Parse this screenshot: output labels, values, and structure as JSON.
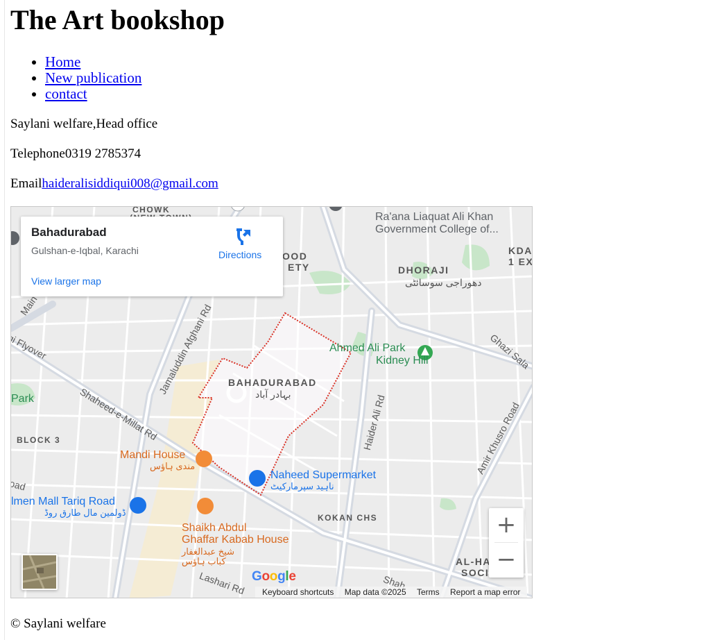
{
  "header": {
    "title": "The Art bookshop"
  },
  "nav": [
    {
      "label": "Home"
    },
    {
      "label": "New publication"
    },
    {
      "label": "contact"
    }
  ],
  "contact": {
    "address": "Saylani welfare,Head office",
    "telephone_label": "Telephone",
    "telephone": "0319 2785374",
    "email_label": "Email",
    "email": "haideralisiddiqui008@gmail.com"
  },
  "map": {
    "card": {
      "title": "Bahadurabad",
      "address": "Gulshan-e-Iqbal, Karachi",
      "directions": "Directions",
      "view_larger": "View larger map"
    },
    "labels": {
      "bahadurabad": "BAHADURABAD",
      "bahadurabad_ur": "بہادر آباد",
      "dhoraji": "DHORAJI",
      "dhoraji_ur": "دھوراجی سوسائٹی",
      "ahmed_ali_park": "Ahmed Ali Park",
      "kidney_hill": "Kidney Hill",
      "government_college_1": "Ra'ana Liaquat Ali Khan",
      "government_college_2": "Government College of...",
      "mandi_house": "Mandi House",
      "mandi_house_ur": "مندی ہاؤس",
      "naheed": "Naheed Supermarket",
      "naheed_ur": "ناہید سپرمارکیٹ",
      "dolmen": "lmen Mall Tariq Road",
      "dolmen_ur": "ڈولمین مال طارق روڈ",
      "shaikh_1": "Shaikh Abdul",
      "shaikh_2": "Ghaffar Kabab House",
      "shaikh_ur_1": "شیخ عبدالغفار",
      "shaikh_ur_2": "کباب ہاؤس",
      "kokan": "KOKAN CHS",
      "block3": "BLOCK 3",
      "park": "Park",
      "chowk": "CHOWK",
      "new_town": "(NEW TOWN)",
      "good_society": "OOD",
      "good_society_2": "ETY",
      "kda": "KDA",
      "kda_2": "1 EX",
      "al_ha": "AL-HA",
      "soc": "SOCI",
      "shaheed_millat": "Shaheed-e-Millat Rd",
      "jamaluddin": "Jamaluddin Afghani Rd",
      "haider_ali": "Haider Ali Rd",
      "amir_khusro": "Amir Khusro Road",
      "ghazi_sala": "Ghazi Sala",
      "flyover": "gi Flyover",
      "main_u": "Main U",
      "lashari": "Lashari Rd",
      "shah": "Shah",
      "oad": "oad"
    },
    "zoom_in": "+",
    "zoom_out": "−",
    "google": "Google",
    "footer": {
      "keyboard": "Keyboard shortcuts",
      "map_data": "Map data ©2025",
      "terms": "Terms",
      "report": "Report a map error"
    },
    "colors": {
      "land": "#ececec",
      "road": "#ffffff",
      "boundary": "#d93025",
      "park": "#c8e6c9",
      "accent_blue": "#1a73e8",
      "accent_orange": "#f28c38"
    }
  },
  "footer": {
    "copyright": "© Saylani welfare"
  }
}
